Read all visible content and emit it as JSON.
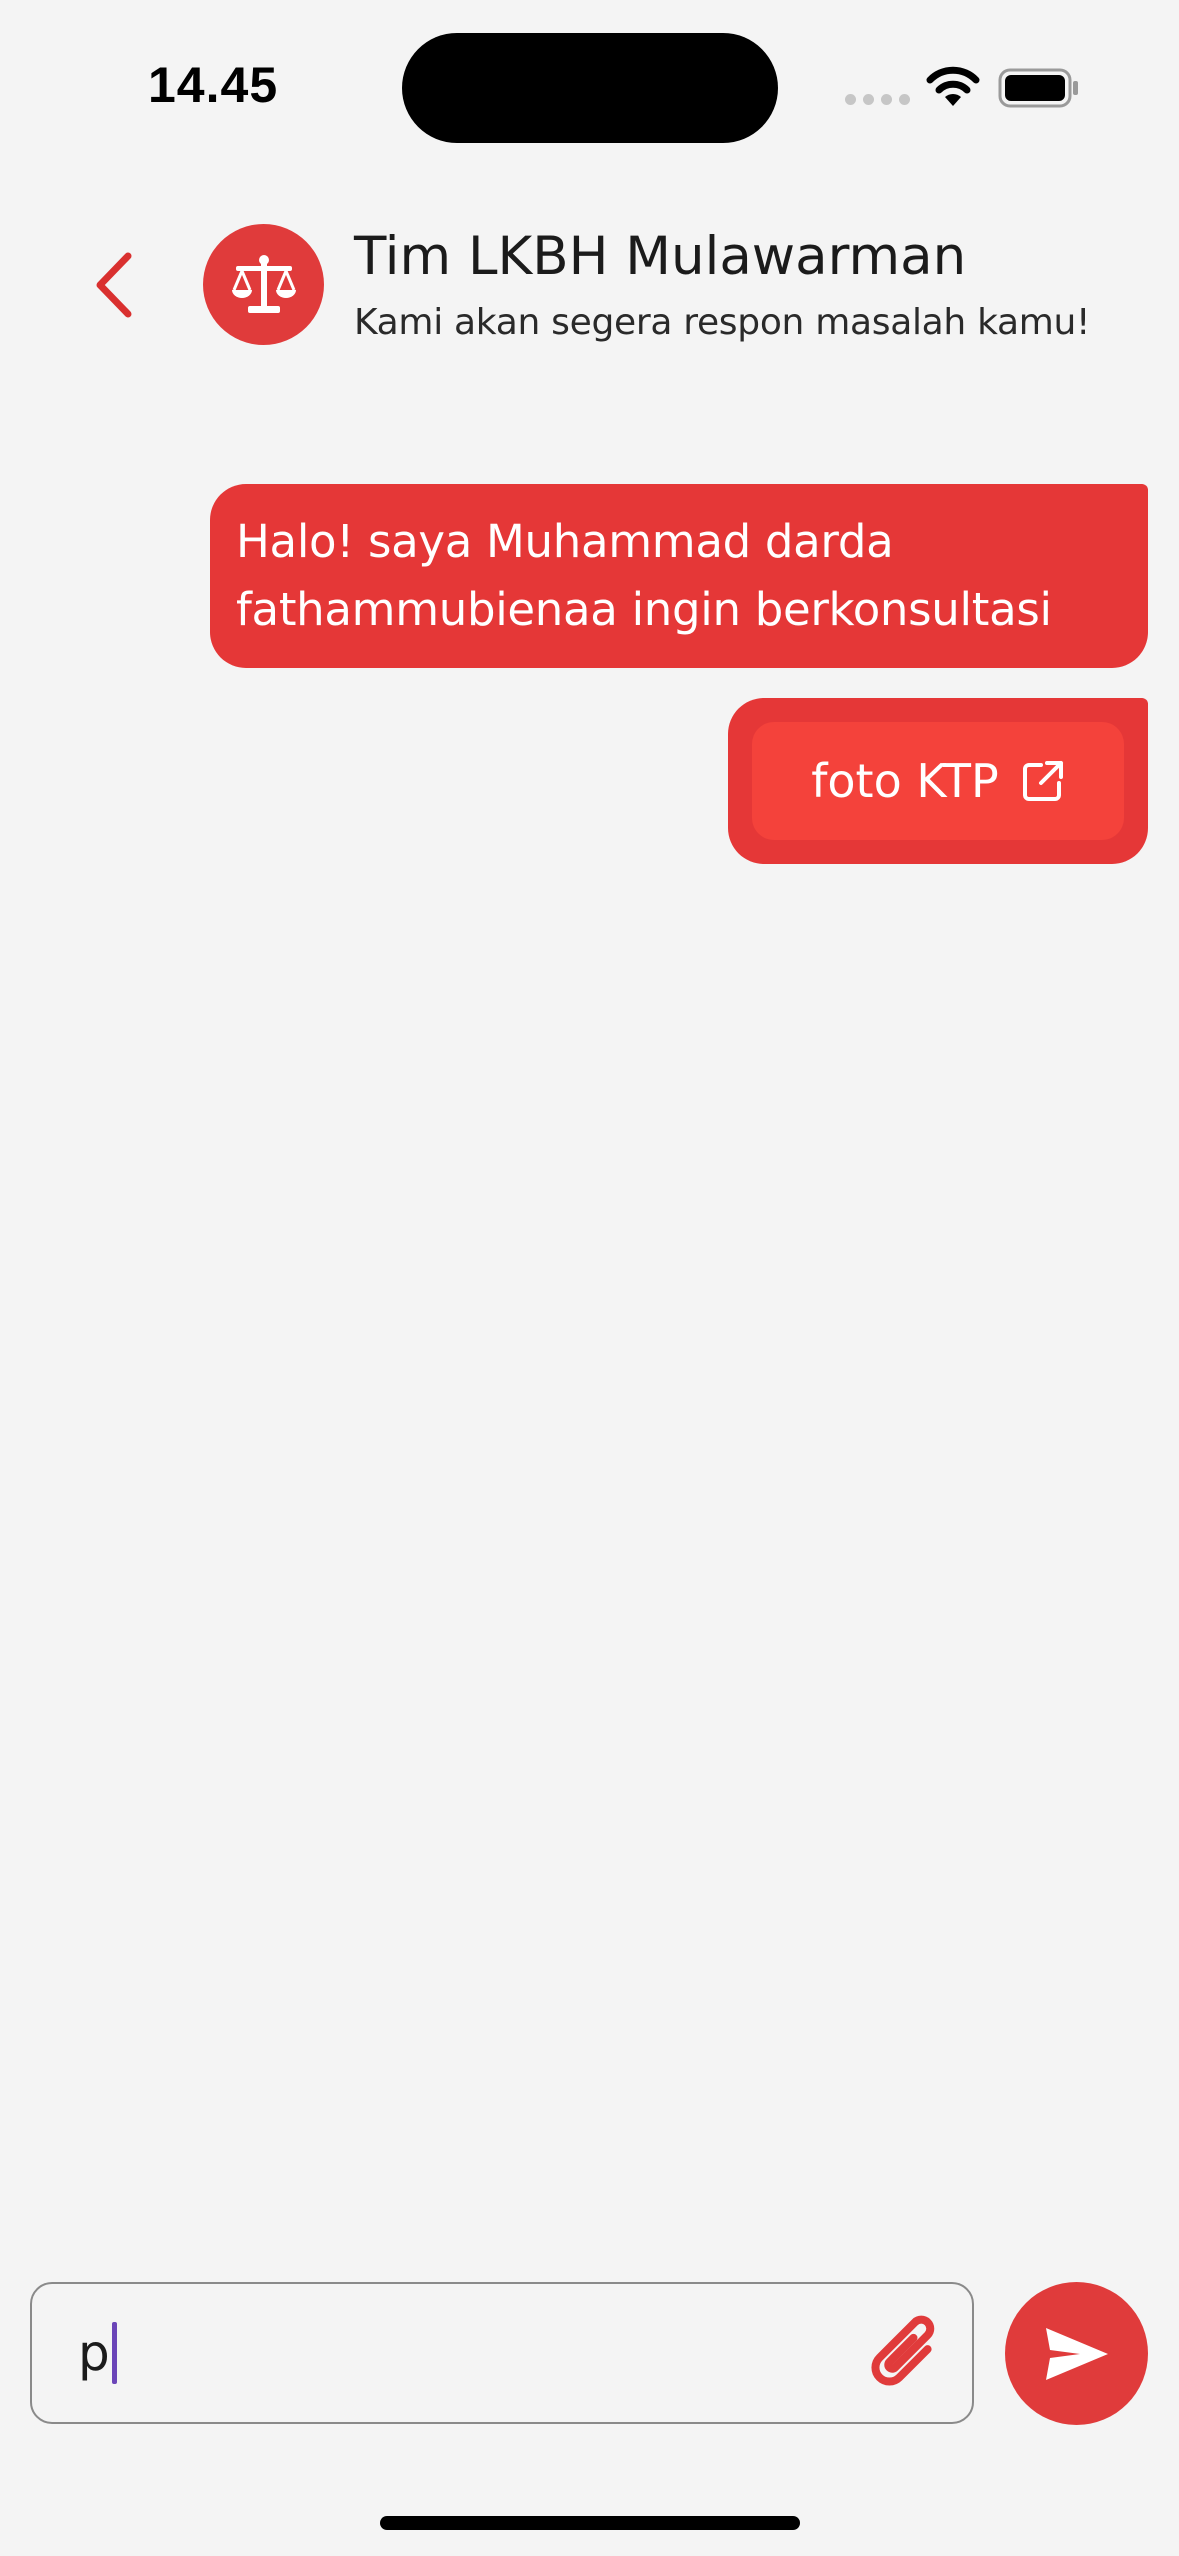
{
  "status_bar": {
    "time": "14.45"
  },
  "header": {
    "title": "Tim LKBH Mulawarman",
    "subtitle": "Kami akan segera respon masalah kamu!",
    "avatar_icon": "scale-of-justice-icon",
    "back_icon": "chevron-left-icon"
  },
  "messages": [
    {
      "type": "text",
      "text": "Halo! saya Muhammad darda fathammubienaa ingin berkonsultasi"
    },
    {
      "type": "file",
      "label": "foto KTP",
      "icon": "external-link-icon"
    }
  ],
  "composer": {
    "value": "p",
    "attach_icon": "paperclip-icon",
    "send_icon": "send-icon"
  },
  "colors": {
    "accent": "#e03b3b",
    "bubble": "#e53737",
    "file_button": "#f4423b",
    "background": "#f4f4f4"
  }
}
